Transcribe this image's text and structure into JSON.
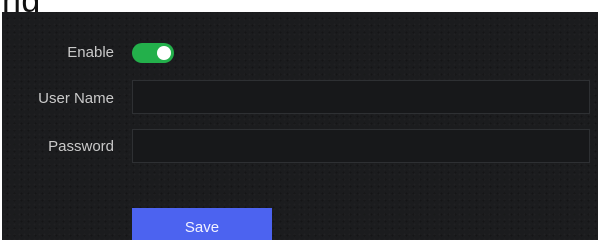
{
  "header": {
    "title_fragment": "ng"
  },
  "form": {
    "enable": {
      "label": "Enable",
      "checked": true,
      "on_color": "#23b04b"
    },
    "user_name": {
      "label": "User Name",
      "value": ""
    },
    "password": {
      "label": "Password",
      "value": ""
    }
  },
  "actions": {
    "save_label": "Save",
    "save_color": "#4c63f0"
  }
}
